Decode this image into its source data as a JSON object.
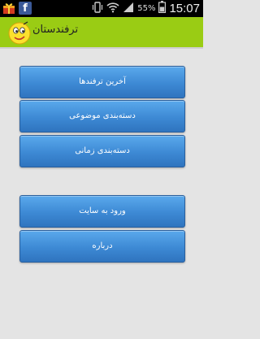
{
  "status_bar": {
    "battery_percent": "55%",
    "time": "15:07",
    "facebook_glyph": "f",
    "icons": [
      "gift-icon",
      "facebook-icon",
      "vibrate-icon",
      "wifi-icon",
      "signal-icon",
      "battery-icon"
    ]
  },
  "app": {
    "title": "ترفندستان",
    "accent_color": "#9acc14"
  },
  "menu": {
    "items": [
      {
        "label": "آخرین ترفندها"
      },
      {
        "label": "دسته‌بندی موضوعی"
      },
      {
        "label": "دسته‌بندی زمانی"
      },
      {
        "label": "ورود به سایت"
      },
      {
        "label": "درباره"
      }
    ],
    "button_color": "#3d89d4"
  }
}
